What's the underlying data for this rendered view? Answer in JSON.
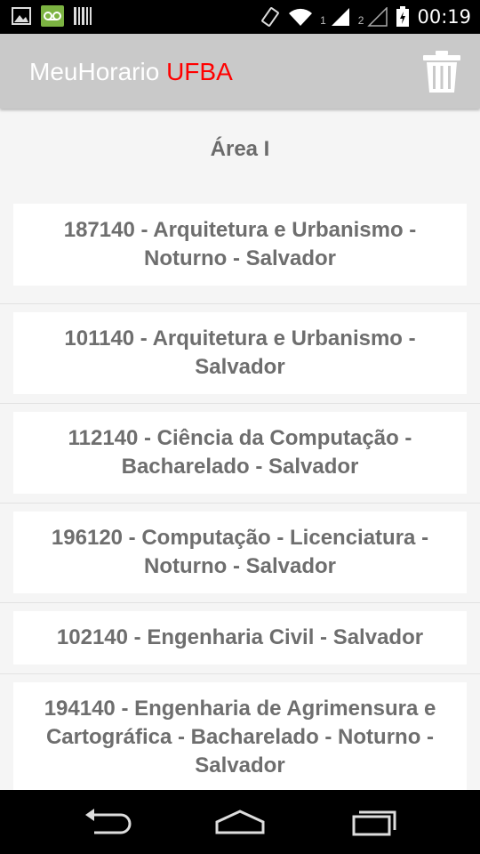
{
  "status_bar": {
    "time": "00:19",
    "sim1": "1",
    "sim2": "2",
    "icons": [
      "image-icon",
      "voicemail-icon",
      "barcode-icon",
      "vibrate-icon",
      "wifi-icon",
      "signal-icon",
      "battery-icon"
    ]
  },
  "app_bar": {
    "title_main": "MeuHorario ",
    "title_accent": "UFBA",
    "accent_color": "#ff0000",
    "action_icon": "trash-icon"
  },
  "section": {
    "title": "Área I"
  },
  "courses": [
    {
      "label": "187140 - Arquitetura e Urbanismo   -\nNoturno - Salvador"
    },
    {
      "label": "101140 - Arquitetura e Urbanismo   -\nSalvador"
    },
    {
      "label": "112140 - Ciência da Computação -\nBacharelado  - Salvador"
    },
    {
      "label": "196120 - Computação - Licenciatura  -\nNoturno - Salvador"
    },
    {
      "label": "102140 - Engenharia Civil   - Salvador"
    },
    {
      "label": "194140 - Engenharia de Agrimensura e\nCartográfica - Bacharelado  - Noturno -\nSalvador"
    }
  ],
  "nav_bar": {
    "icons": [
      "back-icon",
      "home-icon",
      "recent-apps-icon"
    ]
  }
}
